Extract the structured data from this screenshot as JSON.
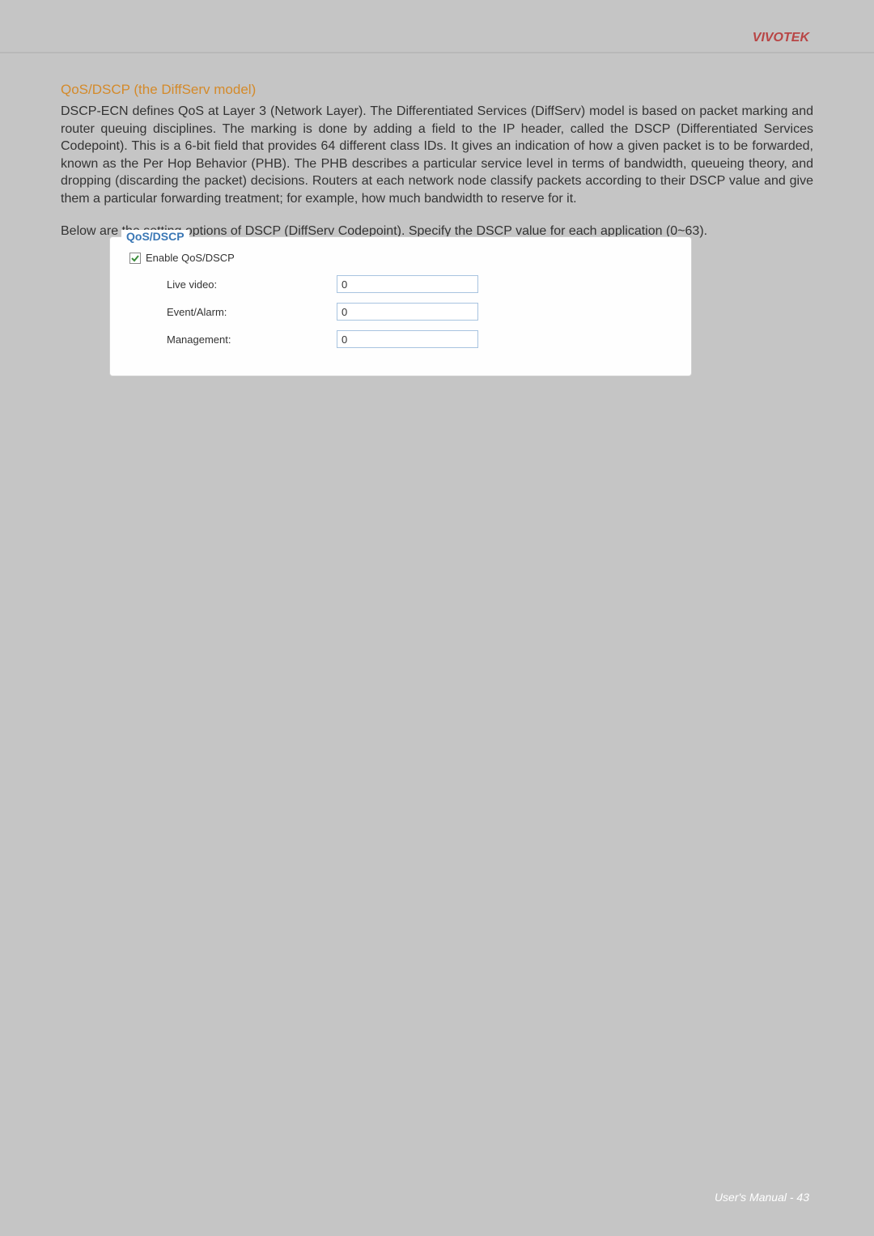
{
  "header": {
    "brand": "VIVOTEK"
  },
  "section": {
    "title": "QoS/DSCP (the DiffServ model)",
    "para1": "DSCP-ECN defines QoS at Layer 3 (Network Layer). The Differentiated Services (DiffServ) model is based on packet marking and router queuing disciplines. The marking is done by adding a field to the IP header, called the DSCP (Differentiated Services Codepoint). This is a 6-bit field that provides 64 different class IDs. It gives an indication of how a given packet is to be forwarded, known as the Per Hop Behavior (PHB). The PHB describes a particular service level in terms of bandwidth, queueing theory, and dropping (discarding the packet) decisions. Routers at each network node classify packets according to their DSCP value and give them a particular forwarding treatment; for example, how much bandwidth to reserve for it.",
    "para2": "Below are the setting options of DSCP (DiffServ Codepoint). Specify the DSCP value for each application (0~63)."
  },
  "settings": {
    "legend": "QoS/DSCP",
    "enable_label": "Enable QoS/DSCP",
    "enable_checked": true,
    "rows": [
      {
        "label": "Live video:",
        "value": "0"
      },
      {
        "label": "Event/Alarm:",
        "value": "0"
      },
      {
        "label": "Management:",
        "value": "0"
      }
    ]
  },
  "footer": {
    "text": "User's Manual - 43"
  }
}
